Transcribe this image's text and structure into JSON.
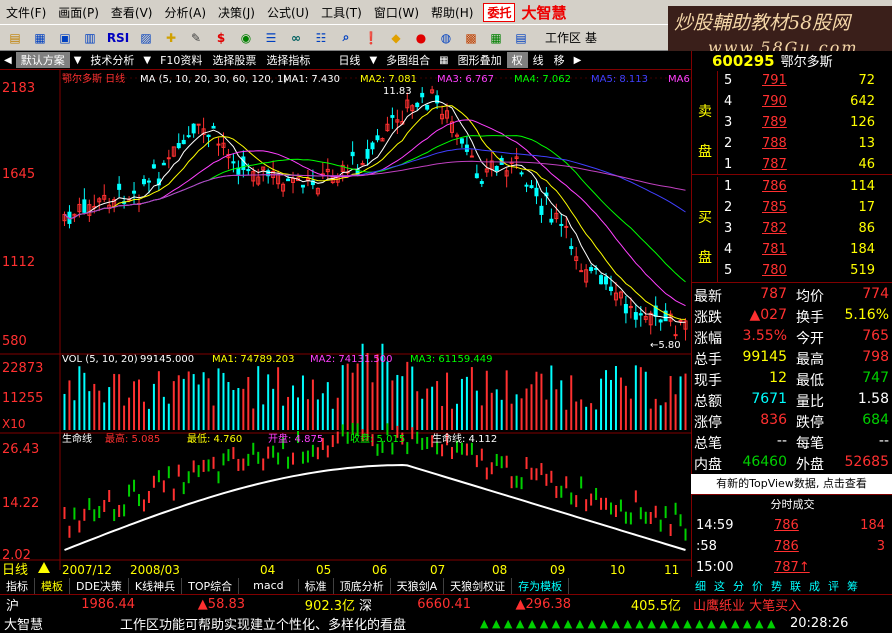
{
  "menu": [
    "文件(F)",
    "画面(P)",
    "查看(V)",
    "分析(A)",
    "决策(J)",
    "公式(U)",
    "工具(T)",
    "窗口(W)",
    "帮助(H)"
  ],
  "menu_extra": {
    "trust": "委托",
    "brand": "大智慧"
  },
  "toolbar": {
    "icons": [
      "folder-icon",
      "grid-icon",
      "window-icon",
      "chart-icon",
      "rsi-icon",
      "indicator-icon",
      "plus-cross-icon",
      "pen-icon",
      "dollar-icon",
      "eye-icon",
      "list-icon",
      "binoculars-icon",
      "list2-icon",
      "search-icon",
      "alert-icon",
      "diamond-icon",
      "f10-icon",
      "dollar-circle-icon",
      "table-icon",
      "grid2-icon",
      "calendar-icon"
    ],
    "labels": [
      "RSI",
      "$"
    ],
    "workarea": "工作区",
    "workarea_suffix": "基"
  },
  "watermark": {
    "line1": "炒股輔助教材58股网",
    "line2": "www.58Gu.com"
  },
  "tabs": {
    "items": [
      "默认方案",
      "技术分析",
      "F10资料",
      "选择股票",
      "选择指标",
      "日线",
      "多图组合",
      "图形叠加",
      "权",
      "线",
      "移"
    ]
  },
  "stock": {
    "code": "600295",
    "name": "鄂尔多斯"
  },
  "kline": {
    "title": "鄂尔多斯 日线",
    "ma": "MA (5, 10, 20, 30, 60, 120, 1)",
    "ma1": "MA1: 7.430",
    "ma2": "MA2: 7.081",
    "ma3": "MA3: 6.767",
    "ma4": "MA4: 7.062",
    "ma5": "MA5: 8.113",
    "ma6": "MA6",
    "price_levels": [
      "2183",
      "1645",
      "1112",
      "580"
    ],
    "high_label": "11.83",
    "low_label": "←5.80"
  },
  "vol": {
    "title": "VOL (5, 10, 20)",
    "v": "99145.000",
    "ma1": "MA1: 74789.203",
    "ma2": "MA2: 74131.500",
    "ma3": "MA3: 61159.449",
    "levels": [
      "22873",
      "11255"
    ],
    "unit": "X10"
  },
  "life": {
    "title": "生命线",
    "high": "最高: 5.085",
    "low": "最低: 4.760",
    "open": "开盘: 4.875",
    "close": "收盘: 5.015",
    "line": "生命线: 4.112",
    "levels": [
      "26.43",
      "14.22",
      "2.02"
    ]
  },
  "dates": [
    "2007/12",
    "2008/03",
    "04",
    "05",
    "06",
    "07",
    "08",
    "09",
    "10",
    "11"
  ],
  "period_label": "日线",
  "orderbook": {
    "sell_label": [
      "卖",
      "盘"
    ],
    "buy_label": [
      "买",
      "盘"
    ],
    "sell": [
      {
        "n": "5",
        "p": "791",
        "v": "72"
      },
      {
        "n": "4",
        "p": "790",
        "v": "642"
      },
      {
        "n": "3",
        "p": "789",
        "v": "126"
      },
      {
        "n": "2",
        "p": "788",
        "v": "13"
      },
      {
        "n": "1",
        "p": "787",
        "v": "46"
      }
    ],
    "buy": [
      {
        "n": "1",
        "p": "786",
        "v": "114"
      },
      {
        "n": "2",
        "p": "785",
        "v": "17"
      },
      {
        "n": "3",
        "p": "782",
        "v": "86"
      },
      {
        "n": "4",
        "p": "781",
        "v": "184"
      },
      {
        "n": "5",
        "p": "780",
        "v": "519"
      }
    ]
  },
  "quote": [
    {
      "l1": "最新",
      "v1": "787",
      "c1": "red",
      "l2": "均价",
      "v2": "774",
      "c2": "red"
    },
    {
      "l1": "涨跌",
      "v1": "▲027",
      "c1": "red",
      "l2": "换手",
      "v2": "5.16%",
      "c2": "yel"
    },
    {
      "l1": "涨幅",
      "v1": "3.55%",
      "c1": "red",
      "l2": "今开",
      "v2": "765",
      "c2": "red"
    },
    {
      "l1": "总手",
      "v1": "99145",
      "c1": "yel",
      "l2": "最高",
      "v2": "798",
      "c2": "red"
    },
    {
      "l1": "现手",
      "v1": "12",
      "c1": "yel",
      "l2": "最低",
      "v2": "747",
      "c2": "grn"
    },
    {
      "l1": "总额",
      "v1": "7671",
      "c1": "cyan",
      "l2": "量比",
      "v2": "1.58",
      "c2": "wht"
    },
    {
      "l1": "涨停",
      "v1": "836",
      "c1": "red",
      "l2": "跌停",
      "v2": "684",
      "c2": "grn"
    },
    {
      "l1": "总笔",
      "v1": "--",
      "c1": "wht",
      "l2": "每笔",
      "v2": "--",
      "c2": "wht"
    },
    {
      "l1": "内盘",
      "v1": "46460",
      "c1": "grn",
      "l2": "外盘",
      "v2": "52685",
      "c2": "red"
    }
  ],
  "notice": "有新的TopView数据, 点击查看",
  "trades": {
    "title": "分时成交",
    "rows": [
      {
        "t": "14:59",
        "p": "786",
        "v": "184"
      },
      {
        "t": ":58",
        "p": "786",
        "v": "3"
      },
      {
        "t": "15:00",
        "p": "787↑",
        "v": ""
      }
    ]
  },
  "bottomtabs": [
    "指标",
    "模板",
    "DDE决策",
    "K线神兵",
    "TOP综合",
    "macd",
    "标准",
    "顶底分析",
    "天狼剑A",
    "天狼剑权证",
    "存为模板"
  ],
  "righttabs": [
    "细",
    "这",
    "分",
    "价",
    "势",
    "联",
    "成",
    "评",
    "筹"
  ],
  "ticker": {
    "sh": "沪",
    "sh_v": "1986.44",
    "sh_c": "▲58.83",
    "sh_a": "902.3亿",
    "sz": "深",
    "sz_v": "6660.41",
    "sz_c": "▲296.38",
    "sz_a": "405.5亿",
    "news": "山鹰纸业 大笔买入"
  },
  "status": {
    "app": "大智慧",
    "msg": "工作区功能可帮助实现建立个性化、多样化的看盘",
    "time": "20:28:26"
  }
}
